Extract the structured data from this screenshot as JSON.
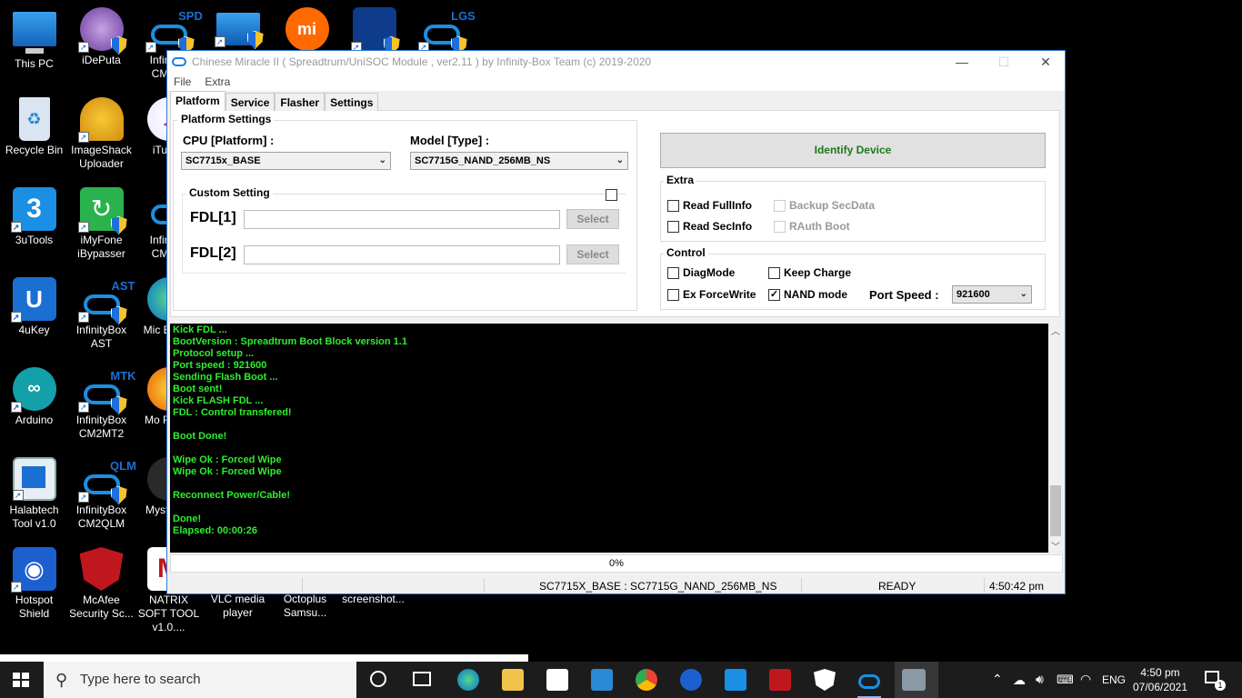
{
  "desktop": {
    "icons": [
      {
        "label": "This PC"
      },
      {
        "label": "iDePuta"
      },
      {
        "label": "Infin CM"
      },
      {
        "label": "Recycle Bin"
      },
      {
        "label": "ImageShack Uploader"
      },
      {
        "label": "iTu"
      },
      {
        "label": "3uTools"
      },
      {
        "label": "iMyFone iBypasser"
      },
      {
        "label": "Infin CM"
      },
      {
        "label": "4uKey"
      },
      {
        "label": "InfinityBox AST"
      },
      {
        "label": "Mic Ed"
      },
      {
        "label": "Arduino"
      },
      {
        "label": "InfinityBox CM2MT2"
      },
      {
        "label": "Mo Fir"
      },
      {
        "label": "Halabtech Tool v1.0"
      },
      {
        "label": "InfinityBox CM2QLM"
      },
      {
        "label": "Myste"
      },
      {
        "label": "Hotspot Shield"
      },
      {
        "label": "McAfee Security Sc..."
      },
      {
        "label": "NATRIX SOFT TOOL v1.0...."
      },
      {
        "label": "VLC media player"
      },
      {
        "label": "Octoplus Samsu..."
      },
      {
        "label": "screenshot..."
      }
    ],
    "icon_tags": {
      "spd": "SPD",
      "ast": "AST",
      "mtk": "MTK",
      "qlm": "QLM",
      "lgs": "LGS",
      "mi": "mi"
    }
  },
  "window": {
    "title": "Chinese Miracle II ( Spreadtrum/UniSOC Module , ver2.11  ) by Infinity-Box Team (c) 2019-2020",
    "controls": {
      "minimize": "—",
      "maximize": "☐",
      "close": "✕"
    },
    "menu": [
      "File",
      "Extra"
    ],
    "tabs": [
      "Platform",
      "Service",
      "Flasher",
      "Settings"
    ],
    "platform_settings": {
      "group_label": "Platform Settings",
      "cpu_label": "CPU [Platform] :",
      "cpu_value": "SC7715x_BASE",
      "model_label": "Model [Type] :",
      "model_value": "SC7715G_NAND_256MB_NS",
      "custom_label": "Custom Setting",
      "fdl1_label": "FDL[1]",
      "fdl2_label": "FDL[2]",
      "select_label": "Select"
    },
    "identify_label": "Identify Device",
    "extra": {
      "label": "Extra",
      "read_fullinfo": "Read FullInfo",
      "backup_secdata": "Backup SecData",
      "read_secinfo": "Read SecInfo",
      "rauth_boot": "RAuth Boot"
    },
    "control": {
      "label": "Control",
      "diagmode": "DiagMode",
      "keep_charge": "Keep Charge",
      "ex_forcewrite": "Ex ForceWrite",
      "nand_mode": "NAND mode",
      "nand_checked": true,
      "port_speed_label": "Port Speed :",
      "port_speed_value": "921600"
    },
    "log": "Kick FDL ...\nBootVersion : Spreadtrum Boot Block version 1.1\nProtocol setup ...\nPort speed : 921600\nSending Flash Boot ...\nBoot sent!\nKick FLASH FDL ...\nFDL : Control transfered!\n\nBoot Done!\n\nWipe Ok : Forced Wipe\nWipe Ok : Forced Wipe\n\nReconnect Power/Cable!\n\nDone!\nElapsed: 00:00:26",
    "progress": "0%",
    "status": {
      "platform": "SC7715X_BASE : SC7715G_NAND_256MB_NS",
      "state": "READY",
      "time": "4:50:42 pm"
    }
  },
  "taskbar": {
    "search_placeholder": "Type here to search",
    "language": "ENG",
    "time": "4:50 pm",
    "date": "07/06/2021",
    "notification_count": "1"
  }
}
